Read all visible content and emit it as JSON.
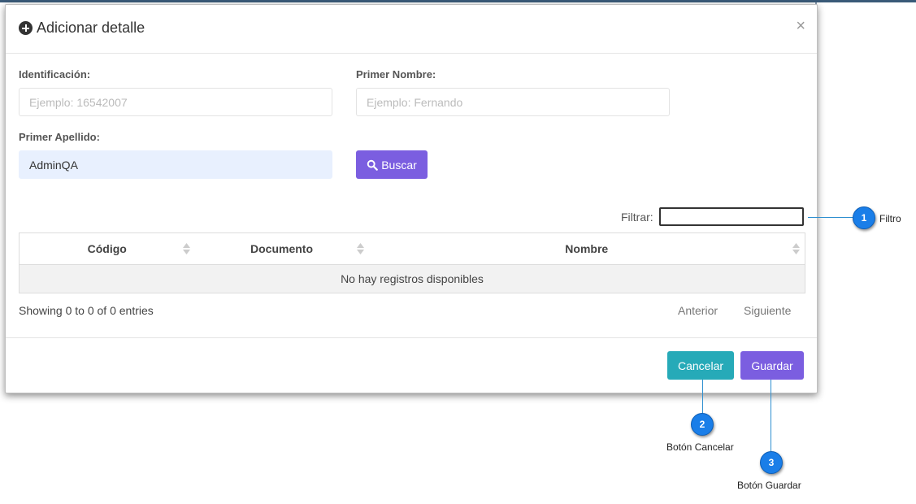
{
  "modal": {
    "title": "Adicionar detalle",
    "close_symbol": "×"
  },
  "form": {
    "identificacion_label": "Identificación:",
    "identificacion_placeholder": "Ejemplo: 16542007",
    "primer_nombre_label": "Primer Nombre:",
    "primer_nombre_placeholder": "Ejemplo: Fernando",
    "primer_apellido_label": "Primer Apellido:",
    "primer_apellido_value": "AdminQA",
    "search_button_label": "Buscar"
  },
  "filter": {
    "label": "Filtrar:",
    "value": ""
  },
  "table": {
    "columns": [
      "Código",
      "Documento",
      "Nombre"
    ],
    "empty_message": "No hay registros disponibles"
  },
  "pagination": {
    "info": "Showing 0 to 0 of 0 entries",
    "previous": "Anterior",
    "next": "Siguiente"
  },
  "footer": {
    "cancel_label": "Cancelar",
    "save_label": "Guardar"
  },
  "callouts": [
    {
      "number": "1",
      "label": "Filtro"
    },
    {
      "number": "2",
      "label": "Botón Cancelar"
    },
    {
      "number": "3",
      "label": "Botón Guardar"
    }
  ],
  "colors": {
    "primary": "#7b5ee0",
    "info": "#26aab8",
    "callout": "#1a7ee8"
  },
  "icons": {
    "title": "plus-circle-icon",
    "search": "search-icon",
    "close": "close-icon",
    "sort": "sort-icon"
  }
}
